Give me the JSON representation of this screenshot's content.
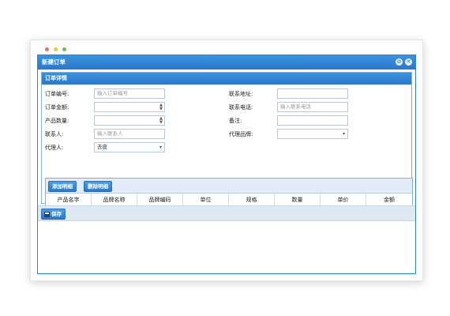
{
  "window": {
    "title": "新建订单"
  },
  "panel": {
    "title": "订单详情"
  },
  "form": {
    "order_no_label": "订单编号:",
    "order_no_placeholder": "输入订单编号",
    "amount_label": "订单金额:",
    "quantity_label": "产品数量:",
    "contact_label": "联系人:",
    "contact_placeholder": "输入联系人",
    "agent_label": "代理人:",
    "agent_value": "去皮",
    "address_label": "联系地址:",
    "phone_label": "联系电话:",
    "phone_placeholder": "输入联系电话",
    "remark_label": "备注:",
    "brand_label": "代理品牌:"
  },
  "toolbar": {
    "add_label": "添加明细",
    "delete_label": "删除明细",
    "save_label": "保存"
  },
  "grid": {
    "columns": [
      "产品名字",
      "品牌名称",
      "品牌编码",
      "单位",
      "规格",
      "数量",
      "单价",
      "金额"
    ]
  },
  "colors": {
    "accent": "#2a78c8",
    "dot_red": "#f26b5b",
    "dot_yellow": "#f6c146",
    "dot_green": "#6cc04a"
  }
}
